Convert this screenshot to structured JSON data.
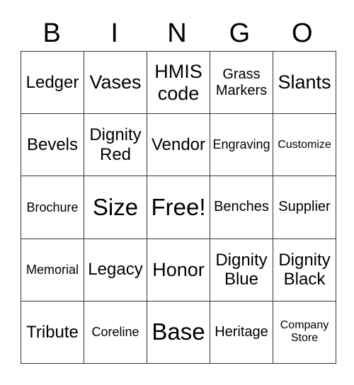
{
  "header": {
    "letters": [
      "B",
      "I",
      "N",
      "G",
      "O"
    ]
  },
  "grid": {
    "rows": [
      [
        {
          "line1": "Ledger",
          "line2": "",
          "size": "s-m"
        },
        {
          "line1": "Vases",
          "line2": "",
          "size": "s-l"
        },
        {
          "line1": "HMIS",
          "line2": "code",
          "size": "s-l"
        },
        {
          "line1": "Grass",
          "line2": "Markers",
          "size": "s-sm"
        },
        {
          "line1": "Slants",
          "line2": "",
          "size": "s-l"
        }
      ],
      [
        {
          "line1": "Bevels",
          "line2": "",
          "size": "s-m"
        },
        {
          "line1": "Dignity",
          "line2": "Red",
          "size": "s-m"
        },
        {
          "line1": "Vendor",
          "line2": "",
          "size": "s-m"
        },
        {
          "line1": "Engraving",
          "line2": "",
          "size": "s-s"
        },
        {
          "line1": "Customize",
          "line2": "",
          "size": "s-xs"
        }
      ],
      [
        {
          "line1": "Brochure",
          "line2": "",
          "size": "s-s"
        },
        {
          "line1": "Size",
          "line2": "",
          "size": "s-xl"
        },
        {
          "line1": "Free!",
          "line2": "",
          "size": "s-xl"
        },
        {
          "line1": "Benches",
          "line2": "",
          "size": "s-sm"
        },
        {
          "line1": "Supplier",
          "line2": "",
          "size": "s-sm"
        }
      ],
      [
        {
          "line1": "Memorial",
          "line2": "",
          "size": "s-s"
        },
        {
          "line1": "Legacy",
          "line2": "",
          "size": "s-m"
        },
        {
          "line1": "Honor",
          "line2": "",
          "size": "s-l"
        },
        {
          "line1": "Dignity",
          "line2": "Blue",
          "size": "s-m"
        },
        {
          "line1": "Dignity",
          "line2": "Black",
          "size": "s-m"
        }
      ],
      [
        {
          "line1": "Tribute",
          "line2": "",
          "size": "s-m"
        },
        {
          "line1": "Coreline",
          "line2": "",
          "size": "s-s"
        },
        {
          "line1": "Base",
          "line2": "",
          "size": "s-xl"
        },
        {
          "line1": "Heritage",
          "line2": "",
          "size": "s-sm"
        },
        {
          "line1": "Company",
          "line2": "Store",
          "size": "s-xs"
        }
      ]
    ]
  }
}
